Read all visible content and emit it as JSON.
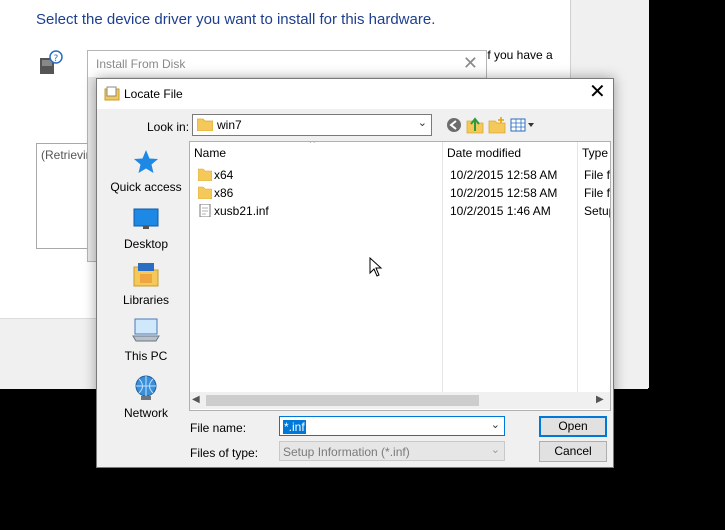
{
  "wizard": {
    "heading": "Select the device driver you want to install for this hardware.",
    "side_text": "If you have a",
    "list_text": "(Retrievin"
  },
  "install_from_disk": {
    "title": "Install From Disk"
  },
  "locate_file": {
    "title": "Locate File",
    "look_in_label": "Look in:",
    "look_in_value": "win7",
    "places": [
      {
        "label": "Quick access",
        "icon": "star-icon"
      },
      {
        "label": "Desktop",
        "icon": "desktop-icon"
      },
      {
        "label": "Libraries",
        "icon": "libraries-icon"
      },
      {
        "label": "This PC",
        "icon": "computer-icon"
      },
      {
        "label": "Network",
        "icon": "network-icon"
      }
    ],
    "columns": {
      "name": "Name",
      "date": "Date modified",
      "type": "Type"
    },
    "files": [
      {
        "name": "x64",
        "date": "10/2/2015 12:58 AM",
        "type": "File fo",
        "icon": "folder-icon"
      },
      {
        "name": "x86",
        "date": "10/2/2015 12:58 AM",
        "type": "File fo",
        "icon": "folder-icon"
      },
      {
        "name": "xusb21.inf",
        "date": "10/2/2015 1:46 AM",
        "type": "Setup",
        "icon": "inf-file-icon"
      }
    ],
    "file_name_label": "File name:",
    "file_name_value": "*.inf",
    "files_of_type_label": "Files of type:",
    "files_of_type_value": "Setup Information (*.inf)",
    "open_label": "Open",
    "cancel_label": "Cancel",
    "scrollbar_fraction": 0.7
  },
  "colors": {
    "accent": "#0078d7",
    "heading": "#1e3f8f",
    "folder": "#f5c85a"
  }
}
